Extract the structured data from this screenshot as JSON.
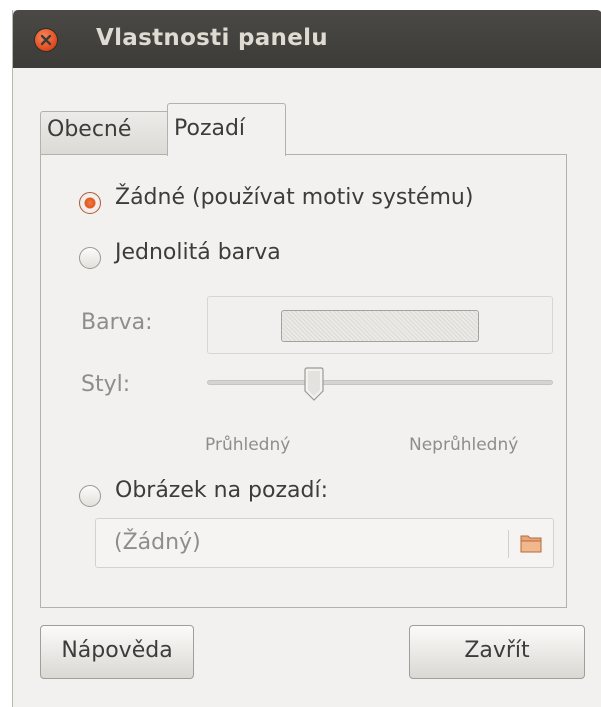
{
  "window": {
    "title": "Vlastnosti panelu"
  },
  "tabs": [
    {
      "label": "Obecné",
      "active": false
    },
    {
      "label": "Pozadí",
      "active": true
    }
  ],
  "background": {
    "options": [
      {
        "label": "Žádné (používat motiv systému)",
        "selected": true
      },
      {
        "label": "Jednolitá barva",
        "selected": false
      },
      {
        "label": "Obrázek na pozadí:",
        "selected": false
      }
    ],
    "color_label": "Barva:",
    "style_label": "Styl:",
    "slider_min_label": "Průhledný",
    "slider_max_label": "Neprůhledný",
    "slider_value": 0.32,
    "image_chooser_value": "(Žádný)"
  },
  "buttons": {
    "help": "Nápověda",
    "close": "Zavřít"
  },
  "icons": [
    "close-icon",
    "folder-icon",
    "slider-handle"
  ],
  "colors": {
    "accent": "#e05a20",
    "titlebar": "#3c3b37"
  }
}
